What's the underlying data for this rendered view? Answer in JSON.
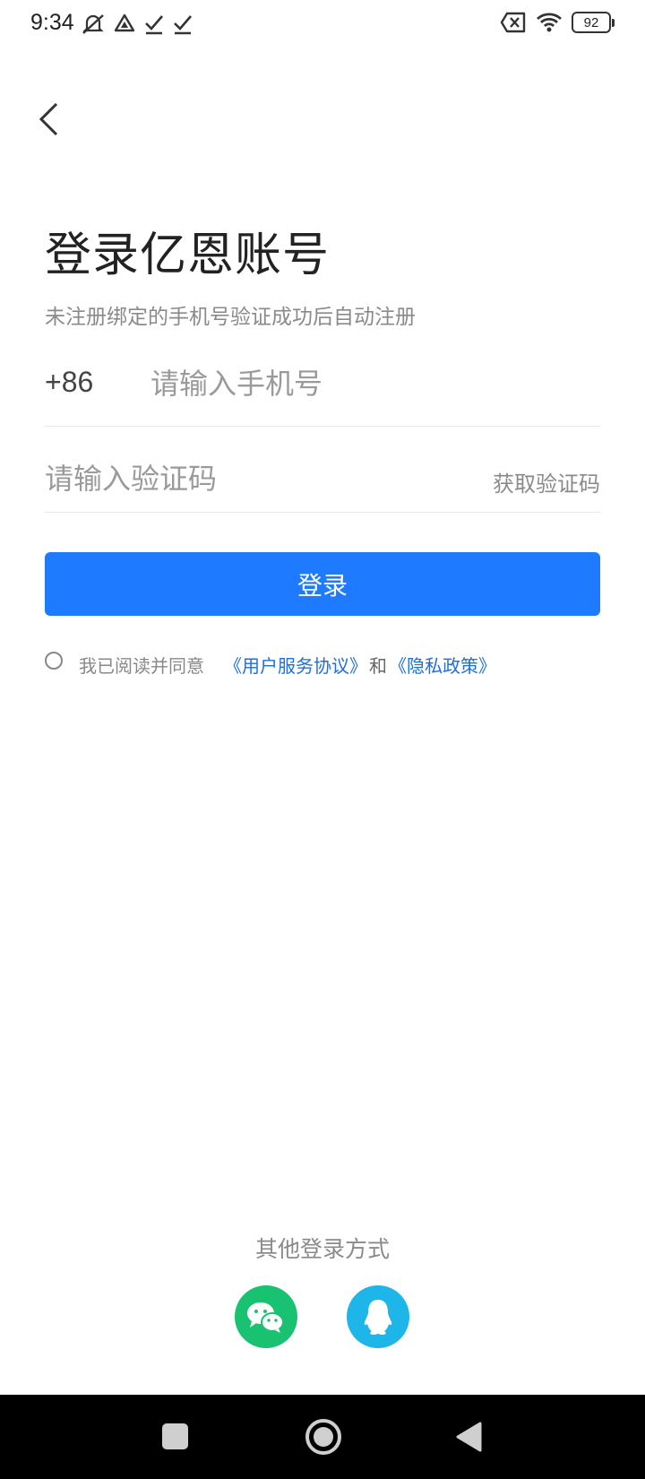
{
  "status_bar": {
    "time": "9:34",
    "left_icons": [
      "bell-off-icon",
      "drive-icon",
      "check-icon",
      "check-icon"
    ],
    "right_icons": [
      "sim-off-icon",
      "wifi-icon"
    ],
    "battery": "92"
  },
  "header": {
    "back_icon": "chevron-left-icon",
    "title": "登录亿恩账号",
    "subtitle": "未注册绑定的手机号验证成功后自动注册"
  },
  "form": {
    "country_code": "+86",
    "phone_placeholder": "请输入手机号",
    "phone_value": "",
    "code_placeholder": "请输入验证码",
    "code_value": "",
    "get_code_label": "获取验证码",
    "login_label": "登录"
  },
  "agreement": {
    "prefix": "我已阅读并同意",
    "terms_link": "《用户服务协议》",
    "and": "和",
    "privacy_link": "《隐私政策》",
    "checked": false
  },
  "other_login": {
    "title": "其他登录方式",
    "options": [
      {
        "icon": "wechat-icon",
        "color": "#18c271"
      },
      {
        "icon": "qq-icon",
        "color": "#1eb6e8"
      }
    ]
  },
  "colors": {
    "accent": "#1e7bff",
    "link": "#1e6fd9"
  },
  "nav_bar": {
    "icons": [
      "recents-icon",
      "home-icon",
      "back-icon"
    ]
  }
}
